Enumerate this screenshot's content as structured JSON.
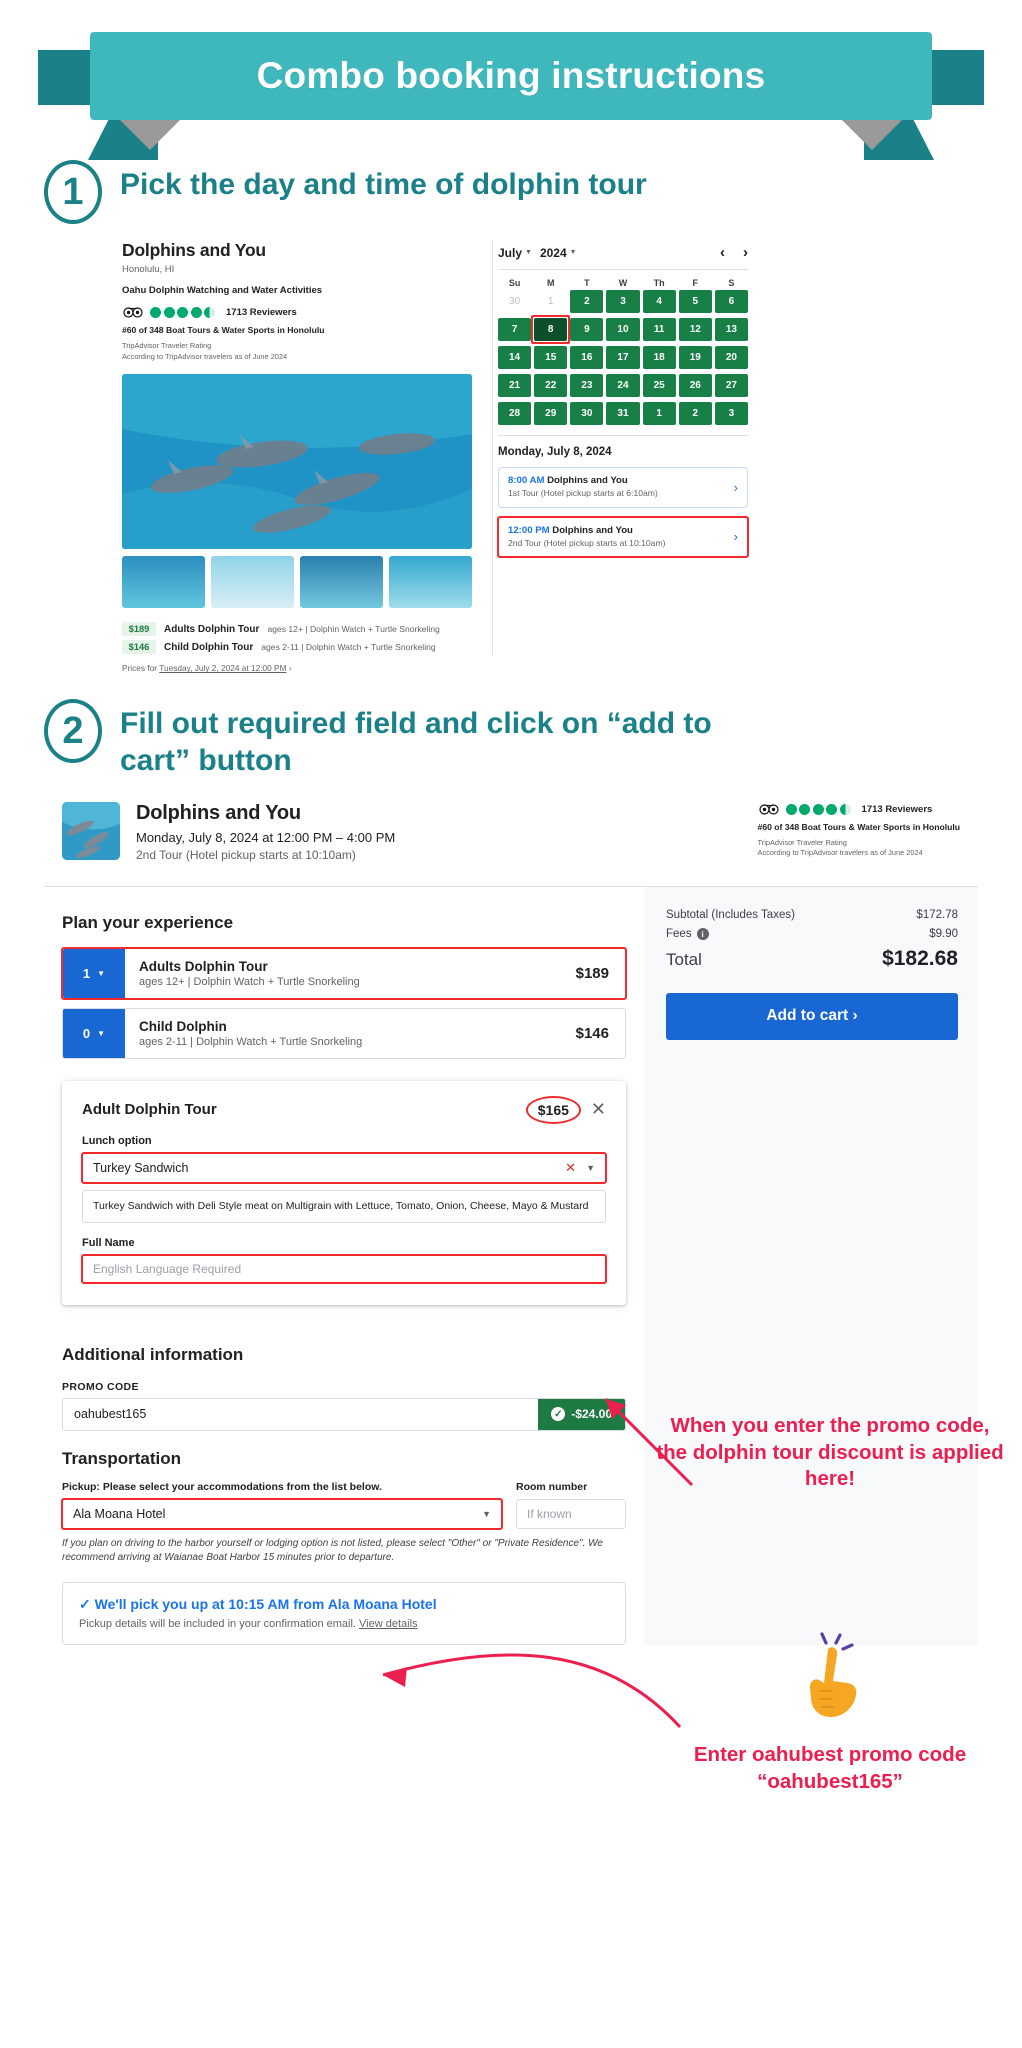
{
  "banner": {
    "title": "Combo booking instructions",
    "color": "#3fb8bd"
  },
  "steps": [
    {
      "number": "1",
      "title": "Pick the day and time of dolphin tour"
    },
    {
      "number": "2",
      "title": "Fill out required field and click on “add to cart” button"
    }
  ],
  "step1": {
    "tour": {
      "name": "Dolphins and You",
      "city": "Honolulu, HI",
      "subtitle": "Oahu Dolphin Watching and Water Activities",
      "reviews": "1713 Reviewers",
      "rank": "#60 of 348 Boat Tours & Water Sports in Honolulu",
      "rating_source_line1": "TripAdvisor Traveler Rating",
      "rating_source_line2": "According to TripAdvisor travelers as of June 2024"
    },
    "prices": [
      {
        "amount": "$189",
        "name": "Adults Dolphin Tour",
        "desc": "ages 12+ | Dolphin Watch + Turtle Snorkeling"
      },
      {
        "amount": "$146",
        "name": "Child Dolphin Tour",
        "desc": "ages 2-11 | Dolphin Watch + Turtle Snorkeling"
      }
    ],
    "prices_for_prefix": "Prices for ",
    "prices_for_link": "Tuesday, July 2, 2024 at 12:00 PM",
    "prices_for_chev": "›",
    "calendar": {
      "month": "July",
      "year": "2024",
      "prev": "‹",
      "next": "›",
      "dow": [
        "Su",
        "M",
        "T",
        "W",
        "Th",
        "F",
        "S"
      ],
      "weeks": [
        [
          {
            "d": "30",
            "s": "muted"
          },
          {
            "d": "1",
            "s": "muted"
          },
          {
            "d": "2",
            "s": "avail"
          },
          {
            "d": "3",
            "s": "avail"
          },
          {
            "d": "4",
            "s": "avail"
          },
          {
            "d": "5",
            "s": "avail"
          },
          {
            "d": "6",
            "s": "avail"
          }
        ],
        [
          {
            "d": "7",
            "s": "avail"
          },
          {
            "d": "8",
            "s": "sel"
          },
          {
            "d": "9",
            "s": "avail"
          },
          {
            "d": "10",
            "s": "avail"
          },
          {
            "d": "11",
            "s": "avail"
          },
          {
            "d": "12",
            "s": "avail"
          },
          {
            "d": "13",
            "s": "avail"
          }
        ],
        [
          {
            "d": "14",
            "s": "avail"
          },
          {
            "d": "15",
            "s": "avail"
          },
          {
            "d": "16",
            "s": "avail"
          },
          {
            "d": "17",
            "s": "avail"
          },
          {
            "d": "18",
            "s": "avail"
          },
          {
            "d": "19",
            "s": "avail"
          },
          {
            "d": "20",
            "s": "avail"
          }
        ],
        [
          {
            "d": "21",
            "s": "avail"
          },
          {
            "d": "22",
            "s": "avail"
          },
          {
            "d": "23",
            "s": "avail"
          },
          {
            "d": "24",
            "s": "avail"
          },
          {
            "d": "25",
            "s": "avail"
          },
          {
            "d": "26",
            "s": "avail"
          },
          {
            "d": "27",
            "s": "avail"
          }
        ],
        [
          {
            "d": "28",
            "s": "avail"
          },
          {
            "d": "29",
            "s": "avail"
          },
          {
            "d": "30",
            "s": "avail"
          },
          {
            "d": "31",
            "s": "avail"
          },
          {
            "d": "1",
            "s": "avail"
          },
          {
            "d": "2",
            "s": "avail"
          },
          {
            "d": "3",
            "s": "avail"
          }
        ]
      ],
      "selected_date_label": "Monday, July 8, 2024",
      "slots": [
        {
          "time": "8:00 AM",
          "name": "Dolphins and You",
          "sub": "1st Tour (Hotel pickup starts at 6:10am)",
          "chev": "›",
          "highlighted": false
        },
        {
          "time": "12:00 PM",
          "name": "Dolphins and You",
          "sub": "2nd Tour (Hotel pickup starts at 10:10am)",
          "chev": "›",
          "highlighted": true
        }
      ]
    }
  },
  "step2": {
    "header": {
      "title": "Dolphins and You",
      "datetime": "Monday, July 8, 2024 at 12:00 PM – 4:00 PM",
      "sub": "2nd Tour (Hotel pickup starts at 10:10am)",
      "reviews": "1713 Reviewers",
      "rank": "#60 of 348 Boat Tours & Water Sports in Honolulu",
      "rating_source_line1": "TripAdvisor Traveler Rating",
      "rating_source_line2": "According to TripAdvisor travelers as of June 2024"
    },
    "plan_title": "Plan your experience",
    "tickets": [
      {
        "qty": "1",
        "name": "Adults Dolphin Tour",
        "desc": "ages 12+ | Dolphin Watch + Turtle Snorkeling",
        "price": "$189",
        "highlighted": true
      },
      {
        "qty": "0",
        "name": "Child Dolphin",
        "desc": "ages 2-11 | Dolphin Watch + Turtle Snorkeling",
        "price": "$146",
        "highlighted": false
      }
    ],
    "detail_card": {
      "title": "Adult Dolphin Tour",
      "price": "$165",
      "close": "✕",
      "lunch_label": "Lunch option",
      "lunch_value": "Turkey Sandwich",
      "lunch_clear": "✕",
      "lunch_caret": "▼",
      "lunch_note": "Turkey Sandwich with Deli Style meat on Multigrain with Lettuce, Tomato, Onion, Cheese, Mayo & Mustard",
      "name_label": "Full Name",
      "name_placeholder": "English Language Required"
    },
    "additional_title": "Additional information",
    "promo_label": "PROMO CODE",
    "promo_value": "oahubest165",
    "promo_discount": "-$24.00",
    "promo_check": "✓",
    "transport_title": "Transportation",
    "pickup_label": "Pickup: Please select your accommodations from the list below.",
    "pickup_value": "Ala Moana Hotel",
    "pickup_caret": "▼",
    "room_label": "Room number",
    "room_placeholder": "If known",
    "disclaimer": "If you plan on driving to the harbor yourself or lodging option is not listed, please select \"Other\" or \"Private Residence\". We recommend arriving at Waianae Boat Harbor 15 minutes prior to departure.",
    "pickup_confirm_title": "✓ We'll pick you up at 10:15 AM from Ala Moana Hotel",
    "pickup_confirm_sub_prefix": "Pickup details will be included in your confirmation email. ",
    "pickup_confirm_link": "View details",
    "summary": {
      "subtotal_label": "Subtotal (Includes Taxes)",
      "subtotal_value": "$172.78",
      "fees_label": "Fees",
      "fees_value": "$9.90",
      "total_label": "Total",
      "total_value": "$182.68",
      "cart_button": "Add to cart ›"
    }
  },
  "annotations": {
    "promo_applied": "When you enter the promo code, the dolphin tour discount is applied here!",
    "enter_promo": "Enter oahubest promo code “oahubest165”",
    "color": "#ec2050"
  }
}
